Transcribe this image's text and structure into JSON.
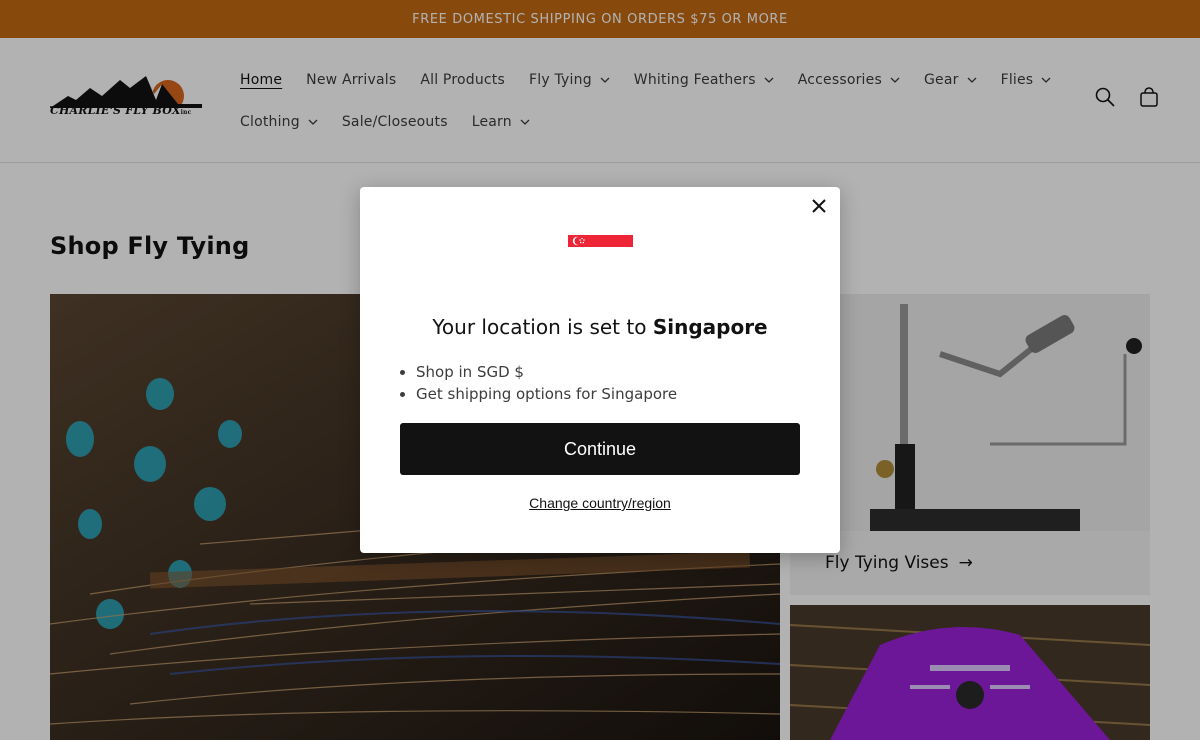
{
  "announcement": {
    "text": "FREE DOMESTIC SHIPPING ON ORDERS $75 OR MORE"
  },
  "header": {
    "logo": {
      "name": "CHARLIE'S FLY BOX",
      "suffix": "inc"
    },
    "nav_row1": [
      {
        "label": "Home",
        "active": true,
        "dropdown": false
      },
      {
        "label": "New Arrivals",
        "dropdown": false
      },
      {
        "label": "All Products",
        "dropdown": false
      },
      {
        "label": "Fly Tying",
        "dropdown": true
      },
      {
        "label": "Whiting Feathers",
        "dropdown": true
      },
      {
        "label": "Accessories",
        "dropdown": true
      },
      {
        "label": "Gear",
        "dropdown": true
      },
      {
        "label": "Flies",
        "dropdown": true
      }
    ],
    "nav_row2": [
      {
        "label": "Clothing",
        "dropdown": true
      },
      {
        "label": "Sale/Closeouts",
        "dropdown": false
      },
      {
        "label": "Learn",
        "dropdown": true
      }
    ],
    "icons": [
      "search-icon",
      "cart-icon"
    ]
  },
  "main": {
    "section_title": "Shop Fly Tying",
    "cards": [
      {
        "caption": "Fly Tying Vises",
        "arrow": "→"
      }
    ]
  },
  "modal": {
    "title_prefix": "Your location is set to",
    "country": "Singapore",
    "bullets": [
      "Shop in SGD $",
      "Get shipping options for Singapore"
    ],
    "continue_label": "Continue",
    "change_label": "Change country/region",
    "close_icon": "close-icon",
    "flag_colors": {
      "top": "#ee2536",
      "bottom": "#ffffff"
    }
  },
  "colors": {
    "announcement_bg": "#c26a12",
    "button_bg": "#121212"
  }
}
